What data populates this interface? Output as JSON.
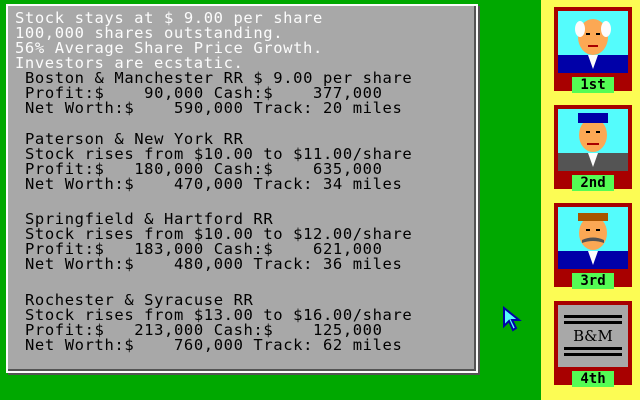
{
  "report": {
    "header_lines": [
      "Stock stays at $ 9.00 per share",
      "100,000 shares outstanding.",
      "56% Average Share Price Growth.",
      "Investors are ecstatic."
    ],
    "companies": [
      {
        "name_line": "Boston & Manchester RR $ 9.00 per share",
        "profit_line": "Profit:$    90,000 Cash:$    377,000",
        "networth_line": "Net Worth:$    590,000 Track: 20 miles"
      },
      {
        "name_line": "Paterson & New York RR",
        "stock_line": "Stock rises from $10.00 to $11.00/share",
        "profit_line": "Profit:$   180,000 Cash:$    635,000",
        "networth_line": "Net Worth:$    470,000 Track: 34 miles"
      },
      {
        "name_line": "Springfield & Hartford RR",
        "stock_line": "Stock rises from $10.00 to $12.00/share",
        "profit_line": "Profit:$   183,000 Cash:$    621,000",
        "networth_line": "Net Worth:$    480,000 Track: 36 miles"
      },
      {
        "name_line": "Rochester & Syracuse RR",
        "stock_line": "Stock rises from $13.00 to $16.00/share",
        "profit_line": "Profit:$   213,000 Cash:$    125,000",
        "networth_line": "Net Worth:$    760,000 Track: 62 miles"
      }
    ]
  },
  "ranking": [
    {
      "rank": "1st",
      "icon": "tycoon-portrait-icon"
    },
    {
      "rank": "2nd",
      "icon": "tycoon-portrait-icon"
    },
    {
      "rank": "3rd",
      "icon": "tycoon-portrait-icon"
    },
    {
      "rank": "4th",
      "logo_text": "B&M"
    }
  ],
  "colors": {
    "background": "#00a800",
    "panel": "#a8a8a8",
    "sidebar": "#fcfc54",
    "card": "#a80000",
    "rank_label": "#54fc54"
  }
}
